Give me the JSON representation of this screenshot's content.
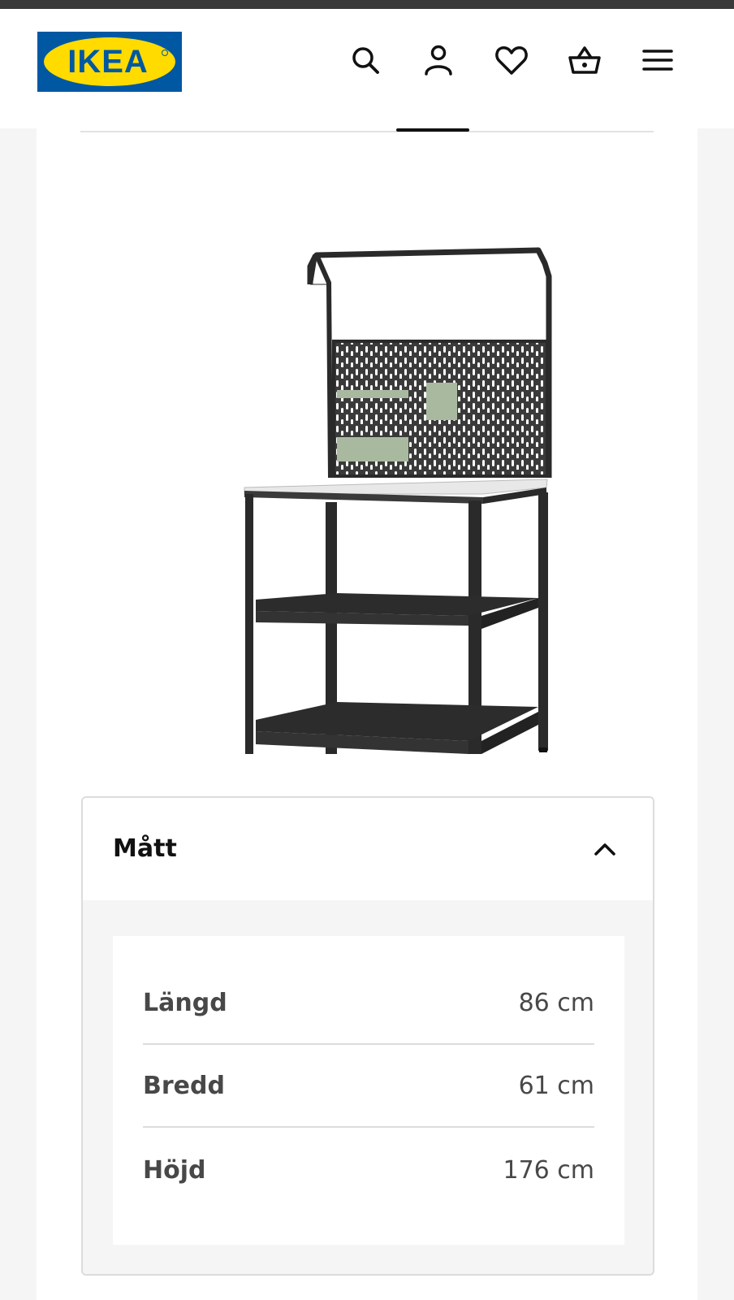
{
  "header": {
    "logo_text": "IKEA",
    "icons": [
      {
        "name": "search-icon"
      },
      {
        "name": "user-icon"
      },
      {
        "name": "heart-icon"
      },
      {
        "name": "cart-icon"
      },
      {
        "name": "menu-icon"
      }
    ]
  },
  "colors": {
    "brand_blue": "#0058a3",
    "brand_yellow": "#ffdb00",
    "background": "#f5f5f5"
  },
  "dimensions_accordion": {
    "title": "Mått",
    "expanded": true,
    "rows": [
      {
        "label": "Längd",
        "value": "86 cm"
      },
      {
        "label": "Bredd",
        "value": "61 cm"
      },
      {
        "label": "Höjd",
        "value": "176 cm"
      }
    ]
  }
}
